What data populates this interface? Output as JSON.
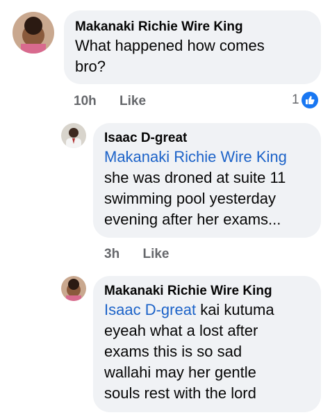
{
  "comments": [
    {
      "author": "Makanaki Richie Wire King",
      "text_lines": [
        "What happened how comes",
        "bro?"
      ],
      "time": "10h",
      "like_label": "Like",
      "reaction_count": "1",
      "reaction_icon": "thumbs-up-icon"
    },
    {
      "author": "Isaac D-great",
      "mention": "Makanaki Richie Wire King",
      "text_lines": [
        "she was droned at suite 11",
        "swimming pool yesterday",
        "evening after her exams..."
      ],
      "time": "3h",
      "like_label": "Like"
    },
    {
      "author": "Makanaki Richie Wire King",
      "mention": "Isaac D-great",
      "text_first": "kai kutuma",
      "text_lines": [
        "eyeah what a lost after",
        "exams this is so sad",
        "wallahi may her gentle",
        "souls rest with the lord"
      ]
    }
  ],
  "colors": {
    "bubble": "#f0f2f5",
    "mention": "#1b62c8",
    "like_blue": "#1877f2",
    "meta_gray": "#65676b"
  }
}
